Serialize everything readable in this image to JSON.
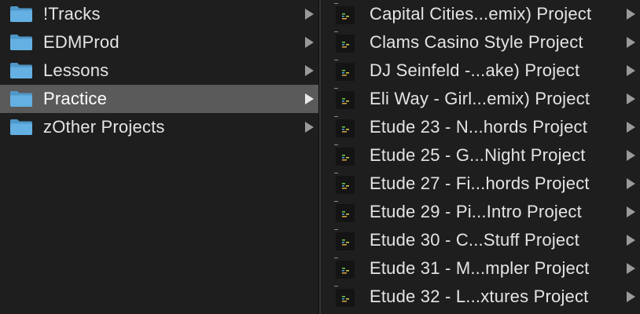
{
  "colors": {
    "background": "#1e1e1e",
    "selected_row": "#5a5a5a",
    "text": "#e4e4e4",
    "folder_blue": "#5fa8d8",
    "chevron": "#9a9a9a"
  },
  "folders": [
    {
      "label": "!Tracks",
      "icon": "folder-icon",
      "selected": false
    },
    {
      "label": "EDMProd",
      "icon": "folder-icon",
      "selected": false
    },
    {
      "label": "Lessons",
      "icon": "folder-icon",
      "selected": false
    },
    {
      "label": "Practice",
      "icon": "folder-icon",
      "selected": true
    },
    {
      "label": "zOther Projects",
      "icon": "folder-icon",
      "selected": false
    }
  ],
  "projects": [
    {
      "label": "Capital Cities...emix) Project",
      "icon": "ableton-project-icon"
    },
    {
      "label": "Clams Casino Style Project",
      "icon": "ableton-project-icon"
    },
    {
      "label": "DJ Seinfeld -...ake) Project",
      "icon": "ableton-project-icon"
    },
    {
      "label": "Eli Way - Girl...emix) Project",
      "icon": "ableton-project-icon"
    },
    {
      "label": "Etude 23 - N...hords Project",
      "icon": "ableton-project-icon"
    },
    {
      "label": "Etude 25 - G...Night Project",
      "icon": "ableton-project-icon"
    },
    {
      "label": "Etude 27 - Fi...hords Project",
      "icon": "ableton-project-icon"
    },
    {
      "label": "Etude 29 - Pi...Intro Project",
      "icon": "ableton-project-icon"
    },
    {
      "label": "Etude 30 - C...Stuff Project",
      "icon": "ableton-project-icon"
    },
    {
      "label": "Etude 31 - M...mpler Project",
      "icon": "ableton-project-icon"
    },
    {
      "label": "Etude 32 - L...xtures Project",
      "icon": "ableton-project-icon"
    }
  ]
}
